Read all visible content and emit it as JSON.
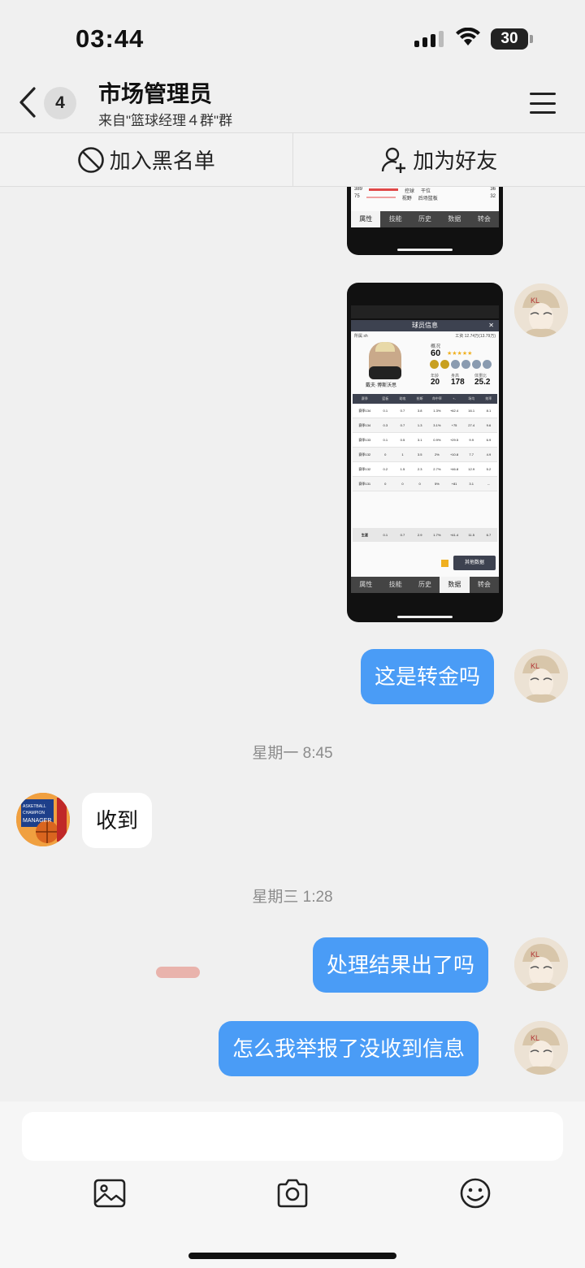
{
  "status_bar": {
    "time": "03:44",
    "battery": "30"
  },
  "header": {
    "unread_count": "4",
    "title": "市场管理员",
    "subtitle": "来自\"篮球经理４群\"群"
  },
  "actions": {
    "block": "加入黑名单",
    "add_friend": "加为好友"
  },
  "screenshot_top": {
    "rows": [
      {
        "left": "389",
        "a": "控球",
        "b": "干位",
        "val": "36"
      },
      {
        "left": "75",
        "a": "视野",
        "b": "后场篮板",
        "val": "32"
      }
    ],
    "tabs": [
      "属性",
      "技能",
      "历史",
      "数据",
      "转会"
    ],
    "active_tab": "属性"
  },
  "screenshot_main": {
    "header": "球员信息",
    "close": "✕",
    "owner": "所属 sh",
    "salary": "工资 12.74万(13.79万)",
    "overall_label": "概况",
    "overall": "60",
    "player_name": "戴夫·博斯沃思",
    "age_label": "年龄",
    "age": "20",
    "height_label": "身高",
    "height": "178",
    "value_label": "体重比",
    "value": "25.2",
    "table_headers": [
      "赛季",
      "篮板",
      "助攻",
      "抢断",
      "命中率",
      "+-",
      "场均",
      "效率"
    ],
    "table_rows": [
      [
        "赛季134",
        "0.1",
        "0.7",
        "3.8",
        "1.3%",
        "+62.4",
        "16.1",
        "8.1"
      ],
      [
        "赛季134",
        "0.3",
        "0.7",
        "1.3",
        "3.1%",
        "+75",
        "27.4",
        "9.6"
      ],
      [
        "赛季133",
        "0.1",
        "0.5",
        "3.1",
        "0.9%",
        "+29.5",
        "9.9",
        "6.9"
      ],
      [
        "赛季132",
        "0",
        "1",
        "3.5",
        "2%",
        "+10.8",
        "7.7",
        "4.9"
      ],
      [
        "赛季132",
        "0.2",
        "1.5",
        "2.3",
        "2.7%",
        "+46.8",
        "12.9",
        "5.2"
      ],
      [
        "赛季131",
        "0",
        "0",
        "0",
        "5%",
        "+81",
        "3.1",
        "--"
      ]
    ],
    "career_row": [
      "生涯",
      "0.1",
      "0.7",
      "2.9",
      "1.7%",
      "+41.4",
      "11.5",
      "6.7"
    ],
    "other_data": "其他数据",
    "tabs": [
      "属性",
      "技能",
      "历史",
      "数据",
      "转会"
    ],
    "active_tab": "数据"
  },
  "messages": {
    "m1": "这是转金吗",
    "ts1": "星期一 8:45",
    "m2": "收到",
    "ts2": "星期三 1:28",
    "m3": "处理结果出了吗",
    "m4": "怎么我举报了没收到信息"
  },
  "admin_avatar_text": "ASKETBALL CHAMPION MANAGER",
  "colors": {
    "bubble_me": "#4a9cf6",
    "bubble_other": "#ffffff",
    "background": "#f0f0f0"
  },
  "icons": [
    "back-chevron-icon",
    "menu-icon",
    "block-icon",
    "add-friend-icon",
    "image-icon",
    "camera-icon",
    "emoji-icon"
  ]
}
